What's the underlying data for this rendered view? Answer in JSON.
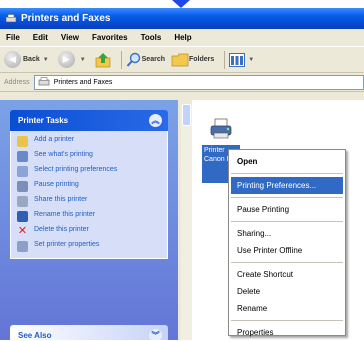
{
  "window": {
    "title": "Printers and Faxes"
  },
  "menubar": [
    "File",
    "Edit",
    "View",
    "Favorites",
    "Tools",
    "Help"
  ],
  "toolbar": {
    "back": "Back",
    "search": "Search",
    "folders": "Folders"
  },
  "address": {
    "label": "Address",
    "value": "Printers and Faxes"
  },
  "tasks": {
    "title": "Printer Tasks",
    "items": [
      {
        "label": "Add a printer",
        "icon": "add-printer-icon"
      },
      {
        "label": "See what's printing",
        "icon": "queue-icon"
      },
      {
        "label": "Select printing preferences",
        "icon": "preferences-icon"
      },
      {
        "label": "Pause printing",
        "icon": "pause-icon"
      },
      {
        "label": "Share this printer",
        "icon": "share-icon"
      },
      {
        "label": "Rename this printer",
        "icon": "rename-icon"
      },
      {
        "label": "Delete this printer",
        "icon": "delete-icon"
      },
      {
        "label": "Set printer properties",
        "icon": "properties-icon"
      }
    ]
  },
  "see_also": {
    "title": "See Also"
  },
  "printer": {
    "label": "Printer Canon Pr"
  },
  "context_menu": {
    "items": [
      {
        "label": "Open",
        "bold": true
      },
      {
        "sep": true
      },
      {
        "label": "Printing Preferences...",
        "highlighted": true
      },
      {
        "sep": true
      },
      {
        "label": "Pause Printing"
      },
      {
        "sep": true
      },
      {
        "label": "Sharing..."
      },
      {
        "label": "Use Printer Offline"
      },
      {
        "sep": true
      },
      {
        "label": "Create Shortcut"
      },
      {
        "label": "Delete"
      },
      {
        "label": "Rename"
      },
      {
        "sep": true
      },
      {
        "label": "Properties"
      }
    ]
  },
  "colors": {
    "accent": "#316ac5",
    "titlebar": "#0548d4",
    "pane": "#6f8ee0"
  }
}
